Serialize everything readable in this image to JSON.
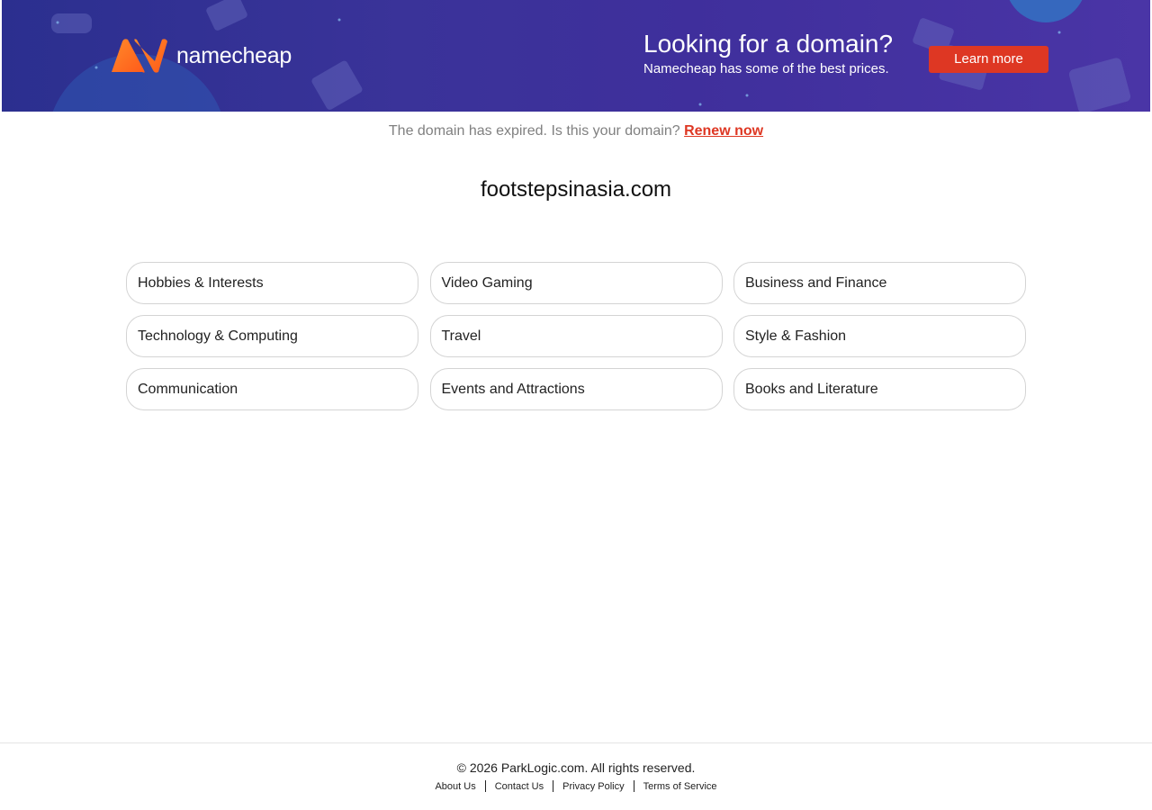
{
  "banner": {
    "logo_text": "namecheap",
    "promo_title": "Looking for a domain?",
    "promo_subtitle": "Namecheap has some of the best prices.",
    "cta_label": "Learn more",
    "colors": {
      "background": "#3a3399",
      "accent": "#de3723",
      "logo_orange": "#ff6a1a"
    }
  },
  "notice": {
    "text": "The domain has expired. Is this your domain?",
    "link_label": "Renew now"
  },
  "domain_name": "footstepsinasia.com",
  "categories": [
    "Hobbies & Interests",
    "Video Gaming",
    "Business and Finance",
    "Technology & Computing",
    "Travel",
    "Style & Fashion",
    "Communication",
    "Events and Attractions",
    "Books and Literature"
  ],
  "footer": {
    "copyright": "© 2026 ParkLogic.com. All rights reserved.",
    "links": [
      "About Us",
      "Contact Us",
      "Privacy Policy",
      "Terms of Service"
    ]
  }
}
